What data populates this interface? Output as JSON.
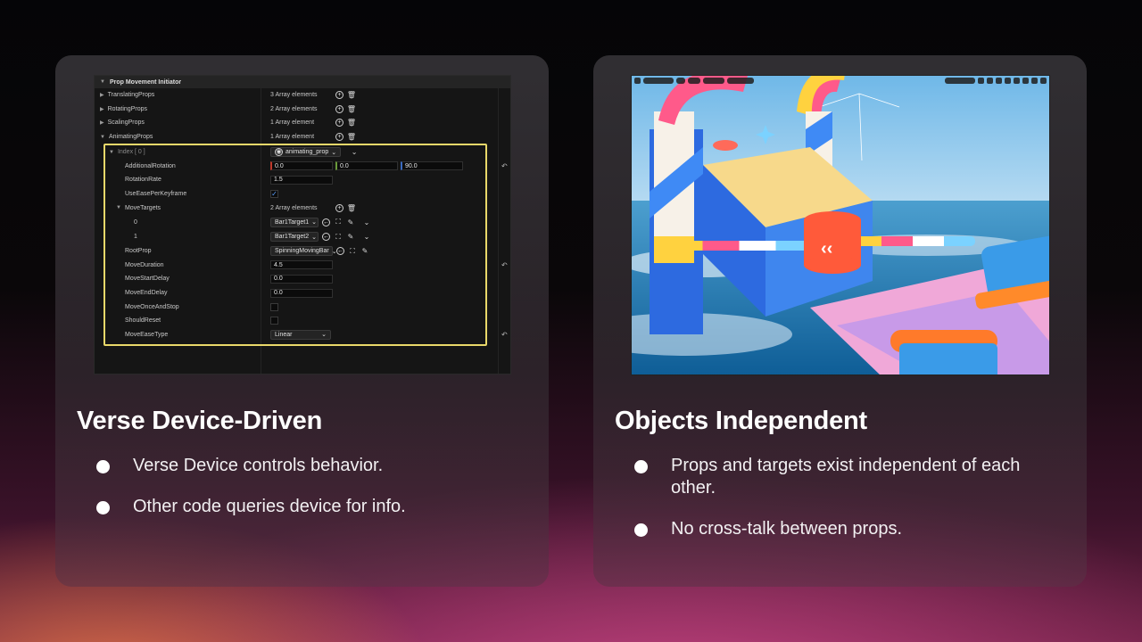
{
  "left_card": {
    "title": "Verse Device-Driven",
    "bullets": [
      "Verse Device controls behavior.",
      "Other code queries device for info."
    ],
    "panel": {
      "header": "Prop Movement Initiator",
      "rows": {
        "translating": {
          "label": "TranslatingProps",
          "value": "3 Array elements"
        },
        "rotating": {
          "label": "RotatingProps",
          "value": "2 Array elements"
        },
        "scaling": {
          "label": "ScalingProps",
          "value": "1 Array element"
        },
        "animating": {
          "label": "AnimatingProps",
          "value": "1 Array element"
        },
        "index": {
          "label": "Index [ 0 ]",
          "value": "animating_prop"
        },
        "additional_rotation": {
          "label": "AdditionalRotation",
          "x": "0.0",
          "y": "0.0",
          "z": "90.0"
        },
        "rotation_rate": {
          "label": "RotationRate",
          "value": "1.5"
        },
        "use_ease": {
          "label": "UseEasePerKeyframe"
        },
        "move_targets": {
          "label": "MoveTargets",
          "value": "2 Array elements"
        },
        "target0": {
          "label": "0",
          "value": "Bar1Target1"
        },
        "target1": {
          "label": "1",
          "value": "Bar1Target2"
        },
        "root_prop": {
          "label": "RootProp",
          "value": "SpinningMovingBar"
        },
        "move_duration": {
          "label": "MoveDuration",
          "value": "4.5"
        },
        "move_start_delay": {
          "label": "MoveStartDelay",
          "value": "0.0"
        },
        "move_end_delay": {
          "label": "MoveEndDelay",
          "value": "0.0"
        },
        "move_once": {
          "label": "MoveOnceAndStop"
        },
        "should_reset": {
          "label": "ShouldReset"
        },
        "move_ease_type": {
          "label": "MoveEaseType",
          "value": "Linear"
        }
      }
    }
  },
  "right_card": {
    "title": "Objects Independent",
    "bullets": [
      "Props and targets exist independent of each other.",
      "No cross-talk between props."
    ]
  },
  "colors": {
    "highlight": "#e9d86a",
    "card_bg": "#333136",
    "accent_pink": "#cd4687"
  },
  "icons": {
    "expand": "triangle-right-icon",
    "collapse": "triangle-down-icon",
    "add": "plus-circle-icon",
    "delete": "trash-icon",
    "reset": "reset-arrow-icon",
    "browse": "arrow-left-circle-icon",
    "select": "select-target-icon",
    "picker": "eyedropper-icon",
    "check": "checkmark-icon"
  }
}
